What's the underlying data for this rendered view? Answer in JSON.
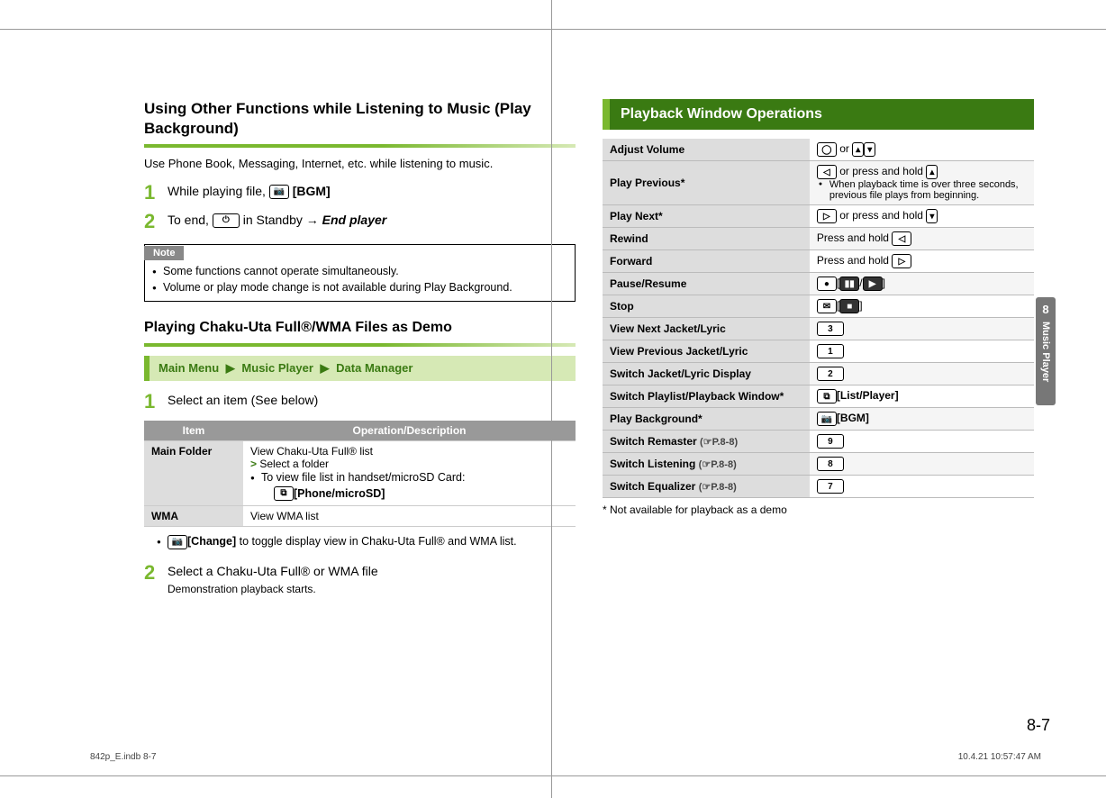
{
  "left": {
    "heading": "Using Other Functions while Listening to Music (Play Background)",
    "subtitle": "Use Phone Book, Messaging, Internet, etc. while listening to music.",
    "step1": "While playing file, ",
    "step1_key_label": "[BGM]",
    "step2_a": "To end, ",
    "step2_b": " in Standby → ",
    "step2_end": "End player",
    "note_label": "Note",
    "notes": [
      "Some functions cannot operate simultaneously.",
      "Volume or play mode change is not available during Play Background."
    ],
    "heading2": "Playing Chaku-Uta Full®/WMA Files as Demo",
    "breadcrumb": [
      "Main Menu",
      "Music Player",
      "Data Manager"
    ],
    "step3": "Select an item (See below)",
    "table_headers": [
      "Item",
      "Operation/Description"
    ],
    "table_rows": [
      {
        "item": "Main Folder",
        "desc_line1": "View Chaku-Uta Full® list",
        "desc_line2": "Select a folder",
        "desc_line3": "To view file list in handset/microSD Card:",
        "desc_key": "[Phone/microSD]"
      },
      {
        "item": "WMA",
        "desc_line1": "View WMA list"
      }
    ],
    "bullet_change_pre": "[Change]",
    "bullet_change_post": " to toggle display view in Chaku-Uta Full® and WMA list.",
    "step4": "Select a Chaku-Uta Full® or WMA file",
    "step4_sub": "Demonstration playback starts."
  },
  "right": {
    "section": "Playback Window Operations",
    "rows": [
      {
        "label": "Adjust Volume",
        "val_icon": "circle",
        "val_text": " or ",
        "val_extra": "updown"
      },
      {
        "label": "Play Previous*",
        "val_icon": "left",
        "val_text": " or press and hold ",
        "val_extra": "up",
        "sub": "When playback time is over three seconds, previous file plays from beginning."
      },
      {
        "label": "Play Next*",
        "val_icon": "right",
        "val_text": " or press and hold ",
        "val_extra": "down"
      },
      {
        "label": "Rewind",
        "val_pre": "Press and hold ",
        "val_icon": "left"
      },
      {
        "label": "Forward",
        "val_pre": "Press and hold ",
        "val_icon": "right"
      },
      {
        "label": "Pause/Resume",
        "val_icon": "dot",
        "val_text": "[",
        "val_mid": "pauseplay",
        "val_end": "]"
      },
      {
        "label": "Stop",
        "val_icon": "mail",
        "val_text": "[",
        "val_mid": "stop",
        "val_end": "]"
      },
      {
        "label": "View Next Jacket/Lyric",
        "key": "3"
      },
      {
        "label": "View Previous Jacket/Lyric",
        "key": "1"
      },
      {
        "label": "Switch Jacket/Lyric Display",
        "key": "2"
      },
      {
        "label": "Switch Playlist/Playback Window*",
        "key_icon": "tv",
        "key_label": "[List/Player]"
      },
      {
        "label": "Play Background*",
        "key_icon": "camera",
        "key_label": "[BGM]"
      },
      {
        "label": "Switch Remaster",
        "ref": "(☞P.8-8)",
        "key": "9"
      },
      {
        "label": "Switch Listening",
        "ref": "(☞P.8-8)",
        "key": "8"
      },
      {
        "label": "Switch Equalizer",
        "ref": "(☞P.8-8)",
        "key": "7"
      }
    ],
    "footnote": "* Not available for playback as a demo"
  },
  "sidetab": {
    "num": "8",
    "label": "Music Player"
  },
  "page_number": "8-7",
  "footer_left": "842p_E.indb   8-7",
  "footer_right": "10.4.21   10:57:47 AM"
}
